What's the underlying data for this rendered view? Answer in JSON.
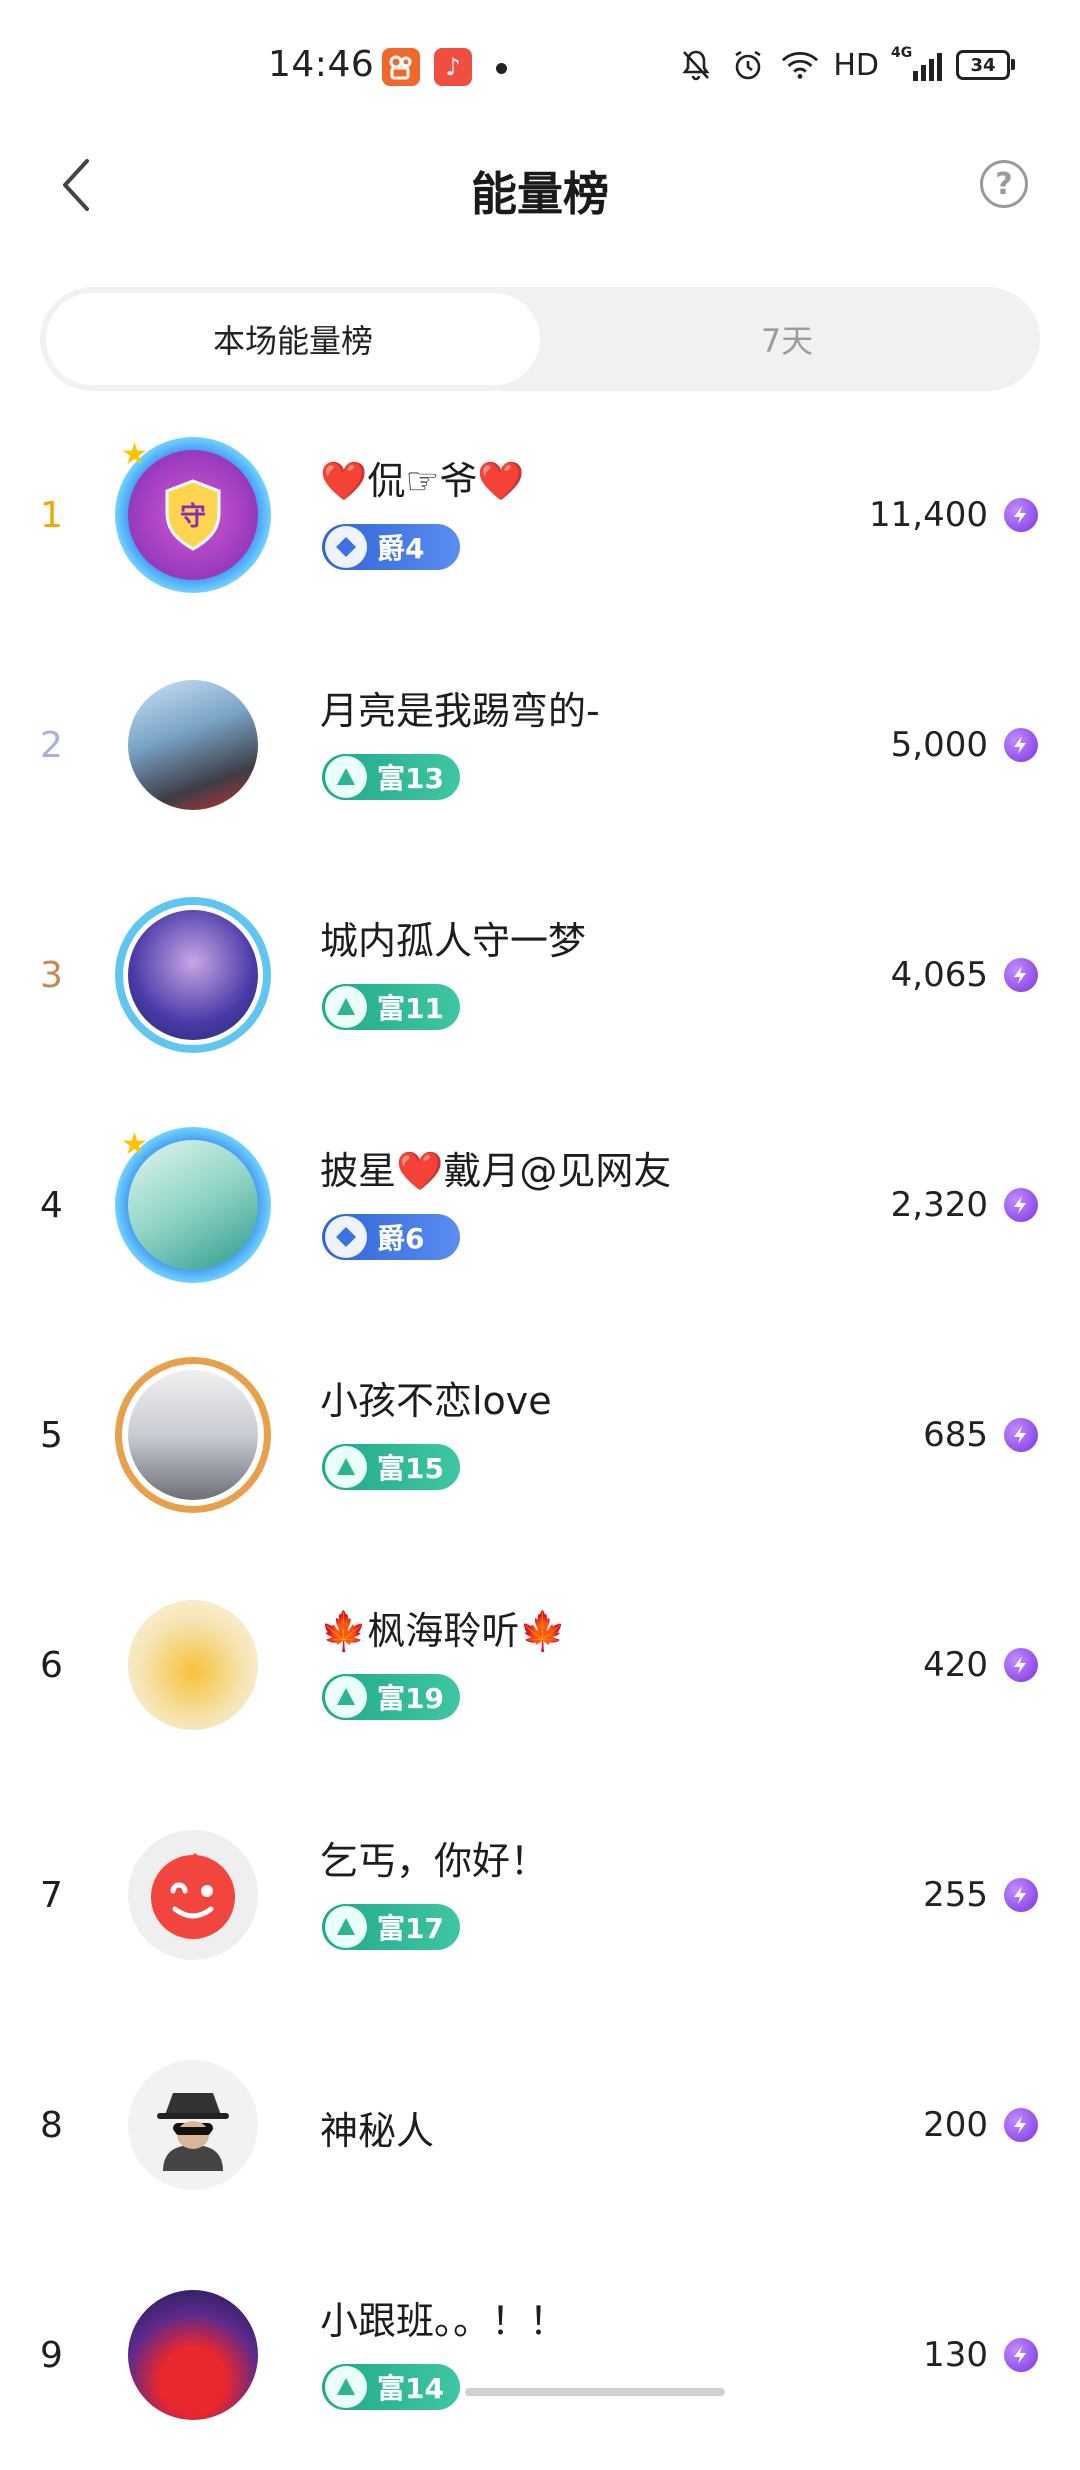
{
  "status_bar": {
    "time": "14:46",
    "network_hd": "HD",
    "network_4g": "4G",
    "battery": "34"
  },
  "header": {
    "title": "能量榜",
    "help": "?"
  },
  "tabs": [
    {
      "label": "本场能量榜",
      "active": true
    },
    {
      "label": "7天",
      "active": false
    }
  ],
  "rankings": [
    {
      "rank": "1",
      "name": "❤️侃☞爷❤️",
      "badge": "爵4",
      "badge_type": "jue",
      "score": "11,400",
      "rank_color": "#f0a800"
    },
    {
      "rank": "2",
      "name": "月亮是我踢弯的-",
      "badge": "富13",
      "badge_type": "fu",
      "score": "5,000",
      "rank_color": "#a8b0e0"
    },
    {
      "rank": "3",
      "name": "城内孤人守一梦",
      "badge": "富11",
      "badge_type": "fu",
      "score": "4,065",
      "rank_color": "#c9884a"
    },
    {
      "rank": "4",
      "name": "披星❤️戴月@见网友",
      "badge": "爵6",
      "badge_type": "jue",
      "score": "2,320",
      "rank_color": "#222222"
    },
    {
      "rank": "5",
      "name": "小孩不恋love",
      "badge": "富15",
      "badge_type": "fu",
      "score": "685",
      "rank_color": "#222222"
    },
    {
      "rank": "6",
      "name": "🍁枫海聆听🍁",
      "badge": "富19",
      "badge_type": "fu",
      "score": "420",
      "rank_color": "#222222"
    },
    {
      "rank": "7",
      "name": "乞丐，你好！",
      "badge": "富17",
      "badge_type": "fu",
      "score": "255",
      "rank_color": "#222222"
    },
    {
      "rank": "8",
      "name": "神秘人",
      "badge": "",
      "badge_type": "",
      "score": "200",
      "rank_color": "#222222"
    },
    {
      "rank": "9",
      "name": "小跟班。。！！",
      "badge": "富14",
      "badge_type": "fu",
      "score": "130",
      "rank_color": "#222222"
    }
  ],
  "colors": {
    "accent_fu": "#2fb493",
    "accent_jue": "#3d72e4",
    "energy": "#8a3ef0"
  }
}
